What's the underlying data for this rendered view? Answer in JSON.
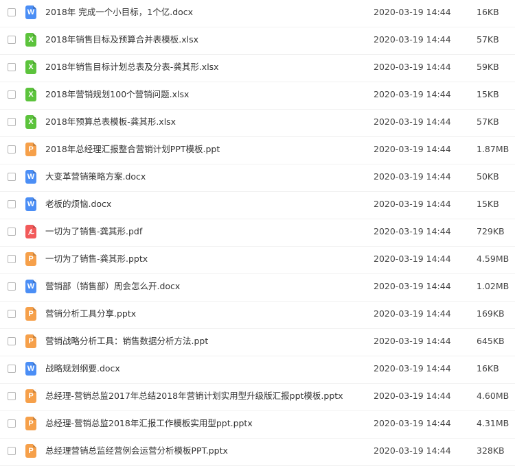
{
  "colors": {
    "word": "#4b8ef5",
    "excel": "#5cc33c",
    "ppt": "#f6a04a",
    "pdf": "#f25a5a"
  },
  "files": [
    {
      "name": "2018年 完成一个小目标，1个亿.docx",
      "date": "2020-03-19 14:44",
      "size": "16KB",
      "type": "word",
      "icon_label": "W",
      "icon": "word-file-icon"
    },
    {
      "name": "2018年销售目标及预算合并表模板.xlsx",
      "date": "2020-03-19 14:44",
      "size": "57KB",
      "type": "excel",
      "icon_label": "X",
      "icon": "excel-file-icon"
    },
    {
      "name": "2018年销售目标计划总表及分表-龚其形.xlsx",
      "date": "2020-03-19 14:44",
      "size": "59KB",
      "type": "excel",
      "icon_label": "X",
      "icon": "excel-file-icon"
    },
    {
      "name": "2018年营销规划100个营销问题.xlsx",
      "date": "2020-03-19 14:44",
      "size": "15KB",
      "type": "excel",
      "icon_label": "X",
      "icon": "excel-file-icon"
    },
    {
      "name": "2018年预算总表模板-龚其形.xlsx",
      "date": "2020-03-19 14:44",
      "size": "57KB",
      "type": "excel",
      "icon_label": "X",
      "icon": "excel-file-icon"
    },
    {
      "name": "2018年总经理汇报整合营销计划PPT模板.ppt",
      "date": "2020-03-19 14:44",
      "size": "1.87MB",
      "type": "ppt",
      "icon_label": "P",
      "icon": "ppt-file-icon"
    },
    {
      "name": "大变革营销策略方案.docx",
      "date": "2020-03-19 14:44",
      "size": "50KB",
      "type": "word",
      "icon_label": "W",
      "icon": "word-file-icon"
    },
    {
      "name": "老板的烦恼.docx",
      "date": "2020-03-19 14:44",
      "size": "15KB",
      "type": "word",
      "icon_label": "W",
      "icon": "word-file-icon"
    },
    {
      "name": "一切为了销售-龚其形.pdf",
      "date": "2020-03-19 14:44",
      "size": "729KB",
      "type": "pdf",
      "icon_label": "",
      "icon": "pdf-file-icon"
    },
    {
      "name": "一切为了销售-龚其形.pptx",
      "date": "2020-03-19 14:44",
      "size": "4.59MB",
      "type": "ppt",
      "icon_label": "P",
      "icon": "ppt-file-icon"
    },
    {
      "name": "营销部（销售部）周会怎么开.docx",
      "date": "2020-03-19 14:44",
      "size": "1.02MB",
      "type": "word",
      "icon_label": "W",
      "icon": "word-file-icon"
    },
    {
      "name": "营销分析工具分享.pptx",
      "date": "2020-03-19 14:44",
      "size": "169KB",
      "type": "ppt",
      "icon_label": "P",
      "icon": "ppt-file-icon"
    },
    {
      "name": "营销战略分析工具：销售数据分析方法.ppt",
      "date": "2020-03-19 14:44",
      "size": "645KB",
      "type": "ppt",
      "icon_label": "P",
      "icon": "ppt-file-icon"
    },
    {
      "name": "战略规划纲要.docx",
      "date": "2020-03-19 14:44",
      "size": "16KB",
      "type": "word",
      "icon_label": "W",
      "icon": "word-file-icon"
    },
    {
      "name": "总经理-营销总监2017年总结2018年营销计划实用型升级版汇报ppt模板.pptx",
      "date": "2020-03-19 14:44",
      "size": "4.60MB",
      "type": "ppt",
      "icon_label": "P",
      "icon": "ppt-file-icon"
    },
    {
      "name": "总经理-营销总监2018年汇报工作模板实用型ppt.pptx",
      "date": "2020-03-19 14:44",
      "size": "4.31MB",
      "type": "ppt",
      "icon_label": "P",
      "icon": "ppt-file-icon"
    },
    {
      "name": "总经理营销总监经营例会运营分析模板PPT.pptx",
      "date": "2020-03-19 14:44",
      "size": "328KB",
      "type": "ppt",
      "icon_label": "P",
      "icon": "ppt-file-icon"
    }
  ]
}
